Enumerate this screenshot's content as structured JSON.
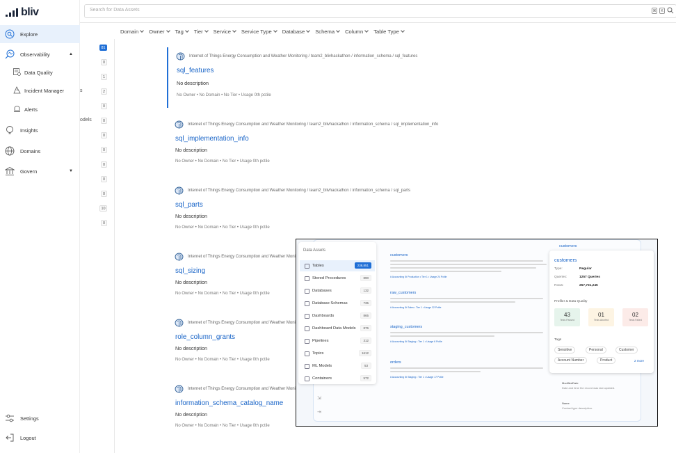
{
  "brand": {
    "name": "bliv"
  },
  "search": {
    "placeholder": "Search for Data Assets"
  },
  "filters": [
    "Domain",
    "Owner",
    "Tag",
    "Tier",
    "Service",
    "Service Type",
    "Database",
    "Schema",
    "Column",
    "Table Type"
  ],
  "sidebar": {
    "items": [
      {
        "label": "Explore",
        "icon": "explore-icon"
      },
      {
        "label": "Observability",
        "icon": "observability-icon"
      },
      {
        "label": "Data Quality",
        "icon": "data-quality-icon"
      },
      {
        "label": "Incident Manager",
        "icon": "incident-manager-icon"
      },
      {
        "label": "Alerts",
        "icon": "alerts-icon"
      },
      {
        "label": "Insights",
        "icon": "insights-icon"
      },
      {
        "label": "Domains",
        "icon": "domains-icon"
      },
      {
        "label": "Govern",
        "icon": "govern-icon"
      }
    ],
    "settings": "Settings",
    "logout": "Logout"
  },
  "counts": [
    "81",
    "0",
    "1",
    "2",
    "0",
    "0",
    "0",
    "0",
    "0",
    "0",
    "0",
    "10",
    "0"
  ],
  "clipped_labels": {
    "s": "s",
    "models": "odels"
  },
  "results": [
    {
      "path": [
        "Internet of Things Energy Consumption and Weather Monitoring",
        "team2_blivhackathon",
        "information_schema",
        "sql_features"
      ],
      "title": "sql_features",
      "desc": "No description",
      "meta": "No Owner  •  No Domain  •  No Tier  •  Usage 0th pctile"
    },
    {
      "path": [
        "Internet of Things Energy Consumption and Weather Monitoring",
        "team2_blivhackathon",
        "information_schema",
        "sql_implementation_info"
      ],
      "title": "sql_implementation_info",
      "desc": "No description",
      "meta": "No Owner  •  No Domain  •  No Tier  •  Usage 0th pctile"
    },
    {
      "path": [
        "Internet of Things Energy Consumption and Weather Monitoring",
        "team2_blivhackathon",
        "information_schema",
        "sql_parts"
      ],
      "title": "sql_parts",
      "desc": "No description",
      "meta": "No Owner  •  No Domain  •  No Tier  •  Usage 0th pctile"
    },
    {
      "path": [
        "Internet of Things Energy Consumption and Weather Monitoring"
      ],
      "title": "sql_sizing",
      "desc": "No description",
      "meta": "No Owner  •  No Domain  •  No Tier  •  Usage 0th pctile"
    },
    {
      "path": [
        "Internet of Things Energy Consumption and Weather Monitoring"
      ],
      "title": "role_column_grants",
      "desc": "No description",
      "meta": "No Owner  •  No Domain  •  No Tier  •  Usage 0th pctile"
    },
    {
      "path": [
        "Internet of Things Energy Consumption and Weather Monitoring"
      ],
      "title": "information_schema_catalog_name",
      "desc": "No description",
      "meta": "No Owner  •  No Domain  •  No Tier  •  Usage 0th pctile"
    }
  ],
  "overlay": {
    "left_header": "Data Assets",
    "assets": [
      {
        "label": "Tables",
        "count": "238,851"
      },
      {
        "label": "Stored Procedures",
        "count": "890"
      },
      {
        "label": "Databases",
        "count": "132"
      },
      {
        "label": "Database Schemas",
        "count": "735"
      },
      {
        "label": "Dashboards",
        "count": "865"
      },
      {
        "label": "Dashboard Data Models",
        "count": "876"
      },
      {
        "label": "Pipelines",
        "count": "312"
      },
      {
        "label": "Topics",
        "count": "1612"
      },
      {
        "label": "ML Models",
        "count": "53"
      },
      {
        "label": "Containers",
        "count": "572"
      }
    ],
    "results": [
      {
        "title": "customers",
        "tags": "# Accounting  ⚙ Production  •  Tier 1  •  Usage 24 Pctile"
      },
      {
        "title": "raw_customers",
        "tags": "# Accounting  ⚙ Sales  •  Tier 1  •  Usage 32 Pctile"
      },
      {
        "title": "staging_customers",
        "tags": "# Accounting  ⚙ Staging  •  Tier 1  •  Usage 6 Pctile"
      },
      {
        "title": "orders",
        "tags": "# Accounting  ⚙ Staging  •  Tier 1  •  Usage 17 Pctile"
      }
    ],
    "detail": {
      "header": "customers",
      "title": "customers",
      "type_label": "Type:",
      "type": "Regular",
      "queries_label": "Queries:",
      "queries": "1257 Queries",
      "rows_label": "Rows:",
      "rows": "257,731,245",
      "quality_header": "Profiler & Data Quality",
      "stats": [
        {
          "value": "43",
          "label": "Tests Passed",
          "color": "#e6f4ec"
        },
        {
          "value": "01",
          "label": "Tests Aborted",
          "color": "#fdf4e3"
        },
        {
          "value": "02",
          "label": "Tests Failed",
          "color": "#fcebe8"
        }
      ],
      "tags_header": "Tags",
      "tags": [
        "Sensitive",
        "Personal",
        "Customer",
        "Account Number",
        "Product"
      ],
      "more": "2 more",
      "bottom": [
        "ModifiedDate",
        "Date and time the record was last updated.",
        "Name",
        "Contact type description."
      ]
    }
  }
}
